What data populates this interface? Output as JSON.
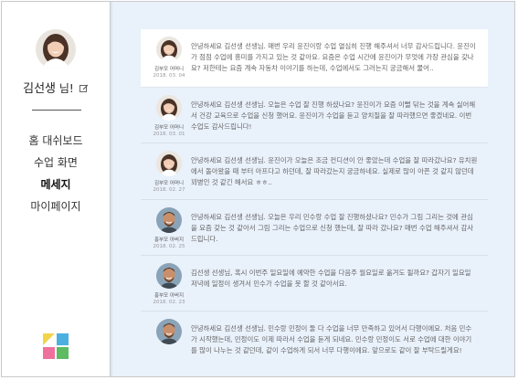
{
  "sidebar": {
    "profile_name": "김선생",
    "profile_suffix": " 님!",
    "nav": [
      {
        "label": "홈 대쉬보드"
      },
      {
        "label": "수업 화면"
      },
      {
        "label": "메세지"
      },
      {
        "label": "마이페이지"
      }
    ]
  },
  "messages": [
    {
      "sender": "김부모 어머니",
      "date": "2018. 03. 04",
      "avatar": "woman",
      "text": "안녕하세요 김선생 선생님. 매번 우리 윤진이랑 수업 열심히 진행 해주셔서 너무 감사드립니다. 윤진이가 점점 수업에 흥미를 가지고 있는 것 같아요. 요즘은 수업 시간에 윤진이가 무엇에 가장 관심을 갖나요? 저한테는 요즘 계속 자동차 이야기를 하는데, 수업에서도 그러는지 궁금해서 물어.."
    },
    {
      "sender": "김부모 어머니",
      "date": "2018. 03. 01",
      "avatar": "woman",
      "text": "안녕하세요 김선생 선생님. 오늘은 수업 잘 진행 하셨나요? 윤진이가 요즘 이뻘 닦는 것을 계속 싫어해서 건강 교육으로 수업을 신청 했어요. 윤진이가 수업을 듣고 양치질을 잘 따라했으면 좋겠네요. 이번 수업도 감사드립니다!"
    },
    {
      "sender": "김부모 어머니",
      "date": "2018. 02. 27",
      "avatar": "woman",
      "text": "안녕하세요 김선생 선생님. 윤진이가 오늘은 조금 컨디션이 안 좋았는데 수업을 잘 따라갔나요? 유치원에서 돌아왔을 때 부터 아프다고 하던데, 잘 따라갔는지 궁금하네요. 실제로 많이 아픈 것 같지 않던데 꾀병인 것 같긴 해서요 ㅎㅎ.."
    },
    {
      "sender": "홍부모 아버지",
      "date": "2018. 02. 25",
      "avatar": "man",
      "text": "안녕하세요 김선생 선생님. 오늘은 우리 민수랑 수업 잘 진행하셨나요? 민수가 그림 그리는 것에 관심을 요즘 갖는 것 같아서 그림 그리는 수업으로 신청 했는데, 잘 따라 갔나요? 매번 수업 해주셔서 감사드립니다."
    },
    {
      "sender": "홍부모 아버지",
      "date": "2018. 02. 23",
      "avatar": "man",
      "text": "김선생 선생님, 혹시 이번주 일요일에 예약한 수업을 다음주 월요일로 옮겨도 될까요? 갑자기 일요일 저녁에 일정이 생겨서 민수가 수업을 못 할 것 같아서요."
    },
    {
      "sender": "",
      "date": "",
      "avatar": "man",
      "text": "안녕하세요 김선생 선생님. 민수랑 민정이 둘 다 수업을 너무 만족하고 있어서 다행이에요. 처음 민수가 시작했는데, 민정이도 이제 따라서 수업을 듣게 되네요. 민수랑 민정이도 서로 수업에 대한 이야기를 많이 나누는 것 같던데, 같이 수업하게 되서 너무 다행이에요. 앞으로도 같이 잘 부탁드릴게요!"
    }
  ]
}
